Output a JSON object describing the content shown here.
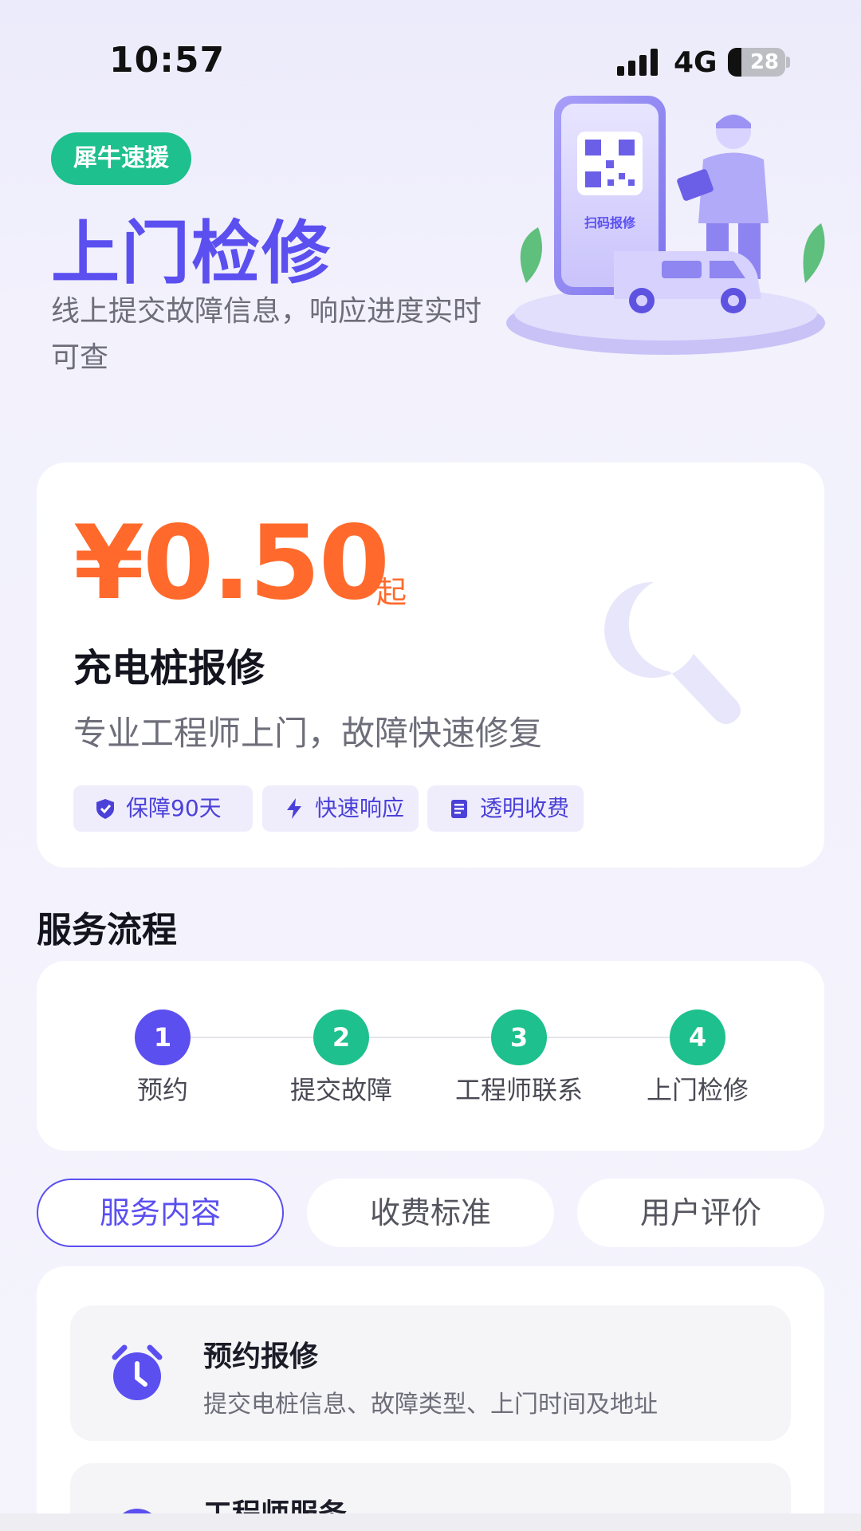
{
  "status_bar": {
    "time": "10:57",
    "network": "4G",
    "battery": "28"
  },
  "hero": {
    "badge": "犀牛速援",
    "title": "上门检修",
    "description": "线上提交故障信息，响应进度实时可查",
    "illustration_text": "扫码报修"
  },
  "price_card": {
    "price": "¥0.50",
    "price_suffix": "起",
    "title": "充电桩报修",
    "description": "专业工程师上门，故障快速修复",
    "tags": [
      {
        "label": "保障90天",
        "icon": "shield-check-icon"
      },
      {
        "label": "快速响应",
        "icon": "lightning-icon"
      },
      {
        "label": "透明收费",
        "icon": "receipt-icon"
      }
    ]
  },
  "process": {
    "title": "服务流程",
    "steps": [
      {
        "number": "1",
        "label": "预约",
        "color": "#5b4ff0"
      },
      {
        "number": "2",
        "label": "提交故障",
        "color": "#1ec08d"
      },
      {
        "number": "3",
        "label": "工程师联系",
        "color": "#1ec08d"
      },
      {
        "number": "4",
        "label": "上门检修",
        "color": "#1ec08d"
      }
    ]
  },
  "tabs": [
    {
      "label": "服务内容",
      "active": true
    },
    {
      "label": "收费标准",
      "active": false
    },
    {
      "label": "用户评价",
      "active": false
    }
  ],
  "content": {
    "items": [
      {
        "title": "预约报修",
        "description": "提交电桩信息、故障类型、上门时间及地址",
        "icon": "alarm-clock-icon"
      },
      {
        "title": "工程师服务",
        "description": "",
        "icon": "engineer-icon"
      }
    ]
  },
  "colors": {
    "accent": "#5b4ff0",
    "green": "#1ec08d",
    "price": "#ff6a2c"
  }
}
